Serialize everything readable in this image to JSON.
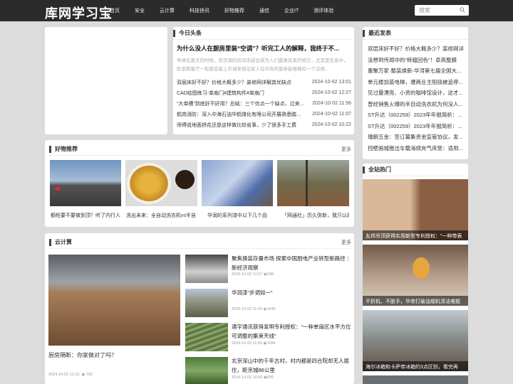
{
  "site": {
    "logo": "库网学习宝",
    "nav": [
      "首页",
      "安全",
      "云计算",
      "科技快讯",
      "好物推荐",
      "通信",
      "企业IT",
      "测评体验"
    ],
    "search_placeholder": "搜索"
  },
  "today": {
    "heading": "今日头条",
    "headline": "为什么没人在厨房里装“空调”？听完工人的解释，我终于不...",
    "summary": "导语在夏天的时候，有空调的房间无疑会成为人们最喜欢呆的地方，尤其是在家中，卧室和客厅一般都会装上空调来保证家人在炎热的夏季能够拥有一个凉爽...",
    "items": [
      {
        "title": "双层床好不好？价格大概多少？装修网详解其优缺点",
        "date": "2024-10-02 13:01"
      },
      {
        "title": "CAD绘图练习-单扇门#建筑构件#单扇门",
        "date": "2024-10-02 12:27"
      },
      {
        "title": "“大单槽”到底好不好用？总结：三个优点一个缺点，过来...",
        "date": "2024-10-02 11:56"
      },
      {
        "title": "鹤岗消防：深入中海石油华鹤煤化有限公司开展熟悉踏查...",
        "date": "2024-10-02 11:07"
      },
      {
        "title": "师傅说地面拼花还是这样做比较省事，少了很多手工费",
        "date": "2024-10-02 10:22"
      }
    ]
  },
  "latest": {
    "heading": "最近发表",
    "items": [
      "双层床好不好？价格大概多少？装修网详",
      "没想到传闻中的“砖缝回色”！卓高整膜",
      "惠聚万家·整装焕新-华浔第七届全国大...",
      "单元楼加装电梯，遭两业主阻挠被追停...",
      "见过最漂亮、小资的咖啡馆设计，这才...",
      "曾经销售火爆的半自动洗衣机为何没人...",
      "ST升达（002259）2023年年报简析：...",
      "ST升达（002259）2023年年报简析：...",
      "瑞朗五金：签订募集资金监管协议，发...",
      "挡壁画城推出车载海绵充气床垫：适用..."
    ]
  },
  "picks": {
    "heading": "好物推荐",
    "more": "更多",
    "items": [
      "橱柜要不要做到顶？听了内行人",
      "洗出未来：全自动洗衣机vs半自",
      "华润的系列漆中以下几个品",
      "「网通社」历久弥新，我只认四"
    ]
  },
  "cloud": {
    "heading": "云计算",
    "more": "更多",
    "main_title": "厨房隔断：你家做对了吗？",
    "main_date": "2024-10-02 12:16",
    "main_views": "792",
    "items": [
      {
        "title": "聚焦换装存量市场 探索中国厨电产业转型新路径｜新经济观察",
        "date": "2024-10-02 12:07",
        "views": "938"
      },
      {
        "title": "华润漆“步调如一”",
        "date": "2024-10-02 11:43",
        "views": "1049"
      },
      {
        "title": "通宇通讯获得发明专利授权：“一种单扇区水平方位可调整的集束天线”",
        "date": "2024-10-02 11:05",
        "views": "1084"
      },
      {
        "title": "北京深山中的千年古村，村内都是四合院却无人居住，距京城86公里",
        "date": "2024-10-02 10:42",
        "views": "895"
      }
    ]
  },
  "hot": {
    "heading": "全站热门",
    "items": [
      "友邦吊顶获得实用新型专利授权：“一种带表",
      "不折机、不脏手，华帝打破油烟机清洁难题",
      "海尔冰箱和卡萨帝冰箱的3点区别，看完再"
    ]
  }
}
